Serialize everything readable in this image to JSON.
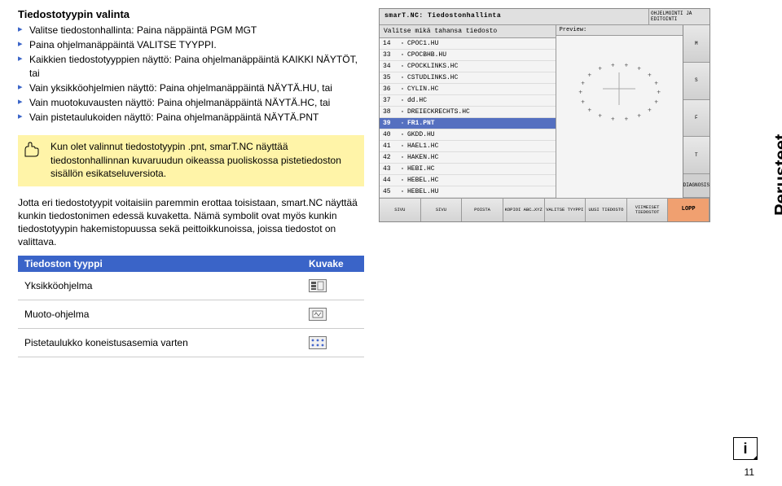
{
  "heading": "Tiedostotyypin valinta",
  "steps": [
    "Valitse tiedostonhallinta: Paina näppäintä PGM MGT",
    "Paina ohjelmanäppäintä VALITSE TYYPPI.",
    "Kaikkien tiedostotyyppien näyttö: Paina ohjelmanäppäintä KAIKKI NÄYTÖT, tai",
    "Vain yksikköohjelmien näyttö: Paina ohjelmanäppäintä NÄYTÄ.HU, tai",
    "Vain muotokuvausten näyttö: Paina ohjelmanäppäintä NÄYTÄ.HC, tai",
    "Vain pistetaulukoiden näyttö: Paina ohjelmanäppäintä NÄYTÄ.PNT"
  ],
  "note": "Kun olet valinnut tiedostotyypin .pnt, smarT.NC näyttää tiedostonhallinnan kuvaruudun oikeassa puoliskossa pistetiedoston sisällön esikatseluversiota.",
  "body": "Jotta eri tiedostotyypit voitaisiin paremmin erottaa toisistaan, smart.NC näyttää kunkin tiedostonimen edessä kuvaketta. Nämä symbolit ovat myös kunkin tiedostotyypin hakemistopuussa sekä peittoikkunoissa, joissa tiedostot on valittava.",
  "table": {
    "header_left": "Tiedoston tyyppi",
    "header_right": "Kuvake",
    "rows": [
      "Yksikköohjelma",
      "Muoto-ohjelma",
      "Pistetaulukko koneistusasemia varten"
    ]
  },
  "margin_label": "Perusteet",
  "pagenum": "11",
  "screenshot": {
    "title": "smarT.NC: Tiedostonhallinta",
    "title_right": "OHJELMOINTI JA EDITOINTI",
    "subheader": "Valitse mikä tahansa tiedosto",
    "preview_label": "Preview:",
    "files": [
      {
        "num": "14",
        "name": "CPOC1.HU"
      },
      {
        "num": "33",
        "name": "CPOCBHB.HU"
      },
      {
        "num": "34",
        "name": "CPOCKLINKS.HC"
      },
      {
        "num": "35",
        "name": "CSTUDLINKS.HC"
      },
      {
        "num": "36",
        "name": "CYLIN.HC"
      },
      {
        "num": "37",
        "name": "dd.HC"
      },
      {
        "num": "38",
        "name": "DREIECKRECHTS.HC"
      },
      {
        "num": "39",
        "name": "FR1.PNT"
      },
      {
        "num": "40",
        "name": "GKDD.HU"
      },
      {
        "num": "41",
        "name": "HAEL1.HC"
      },
      {
        "num": "42",
        "name": "HAKEN.HC"
      },
      {
        "num": "43",
        "name": "HEBI.HC"
      },
      {
        "num": "44",
        "name": "HEBEL.HC"
      },
      {
        "num": "45",
        "name": "HEBEL.HU"
      }
    ],
    "selected": 7,
    "sidebar": [
      "M",
      "S",
      "F",
      "T",
      "DIAGNOSIS"
    ],
    "softkeys": [
      "SIVU",
      "SIVU",
      "POISTA",
      "KOPIOI ABC→XYZ",
      "VALITSE TYYPPI",
      "UUSI TIEDOSTO",
      "VIIMEISET TIEDOSTOT",
      "LOPP"
    ]
  }
}
